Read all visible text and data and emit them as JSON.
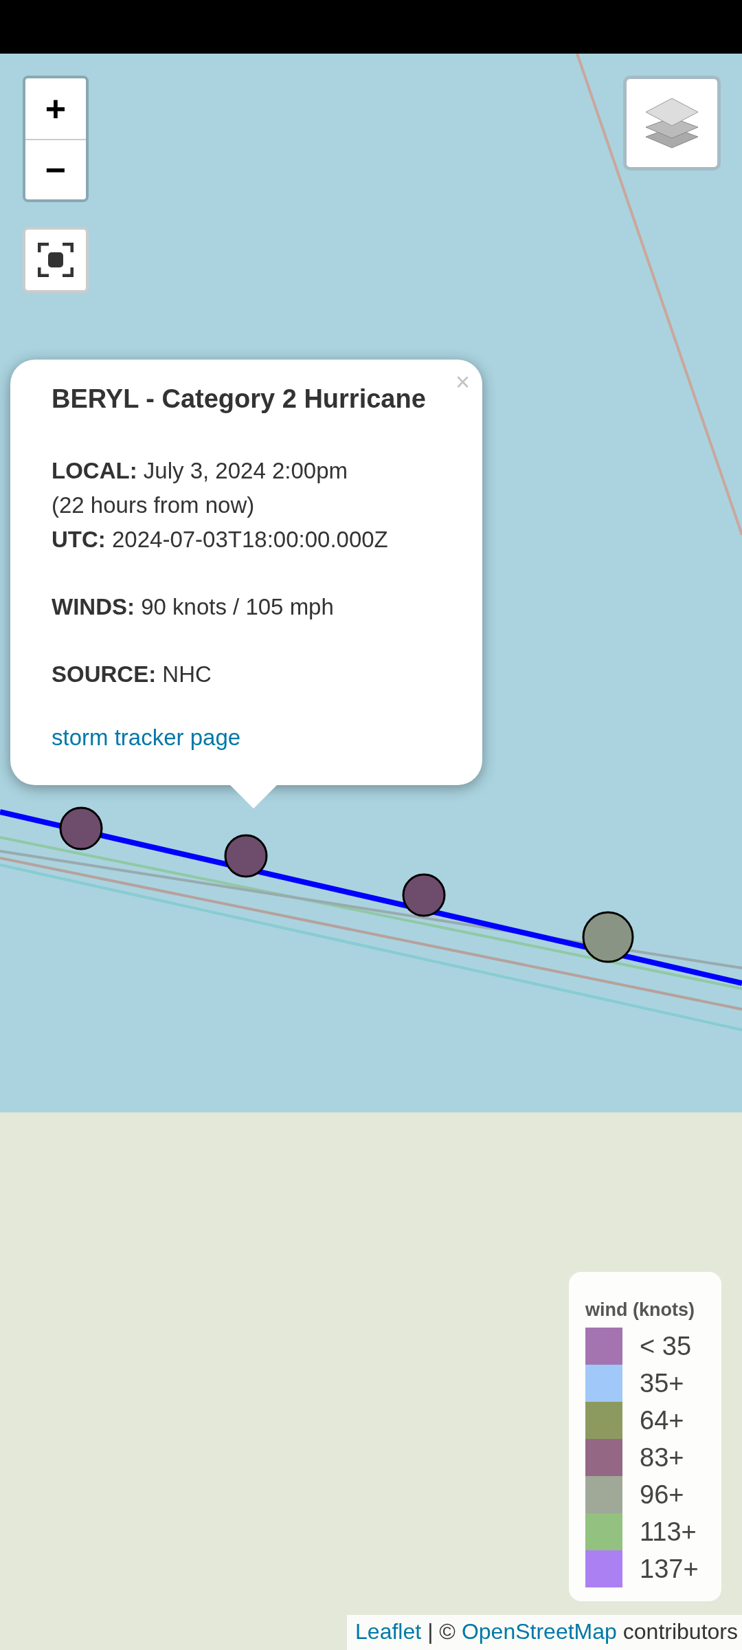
{
  "map": {
    "zoom_in": "+",
    "zoom_out": "−",
    "track_markers": [
      {
        "color": "#6e4c6c"
      },
      {
        "color": "#6e4c6c"
      },
      {
        "color": "#6e4c6c"
      },
      {
        "color": "#8a9484"
      }
    ]
  },
  "popup": {
    "close": "×",
    "title": "BERYL - Category 2 Hurricane",
    "paragraphs": [
      [
        "**LOCAL:** July 3, 2024 2:00pm",
        "(22 hours from now)",
        "**UTC:** 2024-07-03T18:00:00.000Z"
      ],
      [
        "**WINDS:** 90 knots / 105 mph"
      ],
      [
        "**SOURCE:** NHC"
      ]
    ],
    "link": "storm tracker page"
  },
  "legend": {
    "title": "wind (knots)",
    "items": [
      {
        "label": "< 35",
        "color": "#a374b0"
      },
      {
        "label": "35+",
        "color": "#a0c8f8"
      },
      {
        "label": "64+",
        "color": "#8c9a60"
      },
      {
        "label": "83+",
        "color": "#946884"
      },
      {
        "label": "96+",
        "color": "#a0a898"
      },
      {
        "label": "113+",
        "color": "#93c17f"
      },
      {
        "label": "137+",
        "color": "#ab80f2"
      }
    ]
  },
  "attribution": {
    "link_1": "Leaflet",
    "separator": "| ©",
    "link_2": "OpenStreetMap",
    "suffix": "contributors"
  }
}
